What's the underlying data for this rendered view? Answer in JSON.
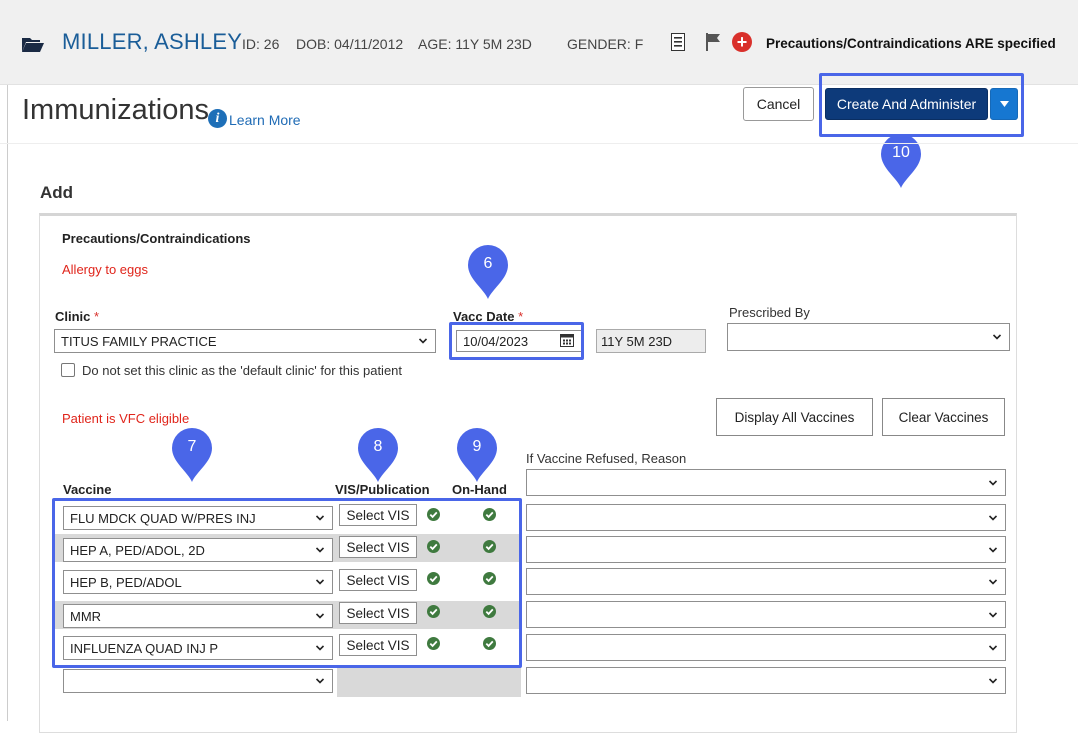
{
  "patient": {
    "name": "MILLER, ASHLEY",
    "id_label": "ID:",
    "id": "26",
    "dob_label": "DOB:",
    "dob": "04/11/2012",
    "age_label": "AGE:",
    "age": "11Y 5M 23D",
    "gender_label": "GENDER:",
    "gender": "F",
    "precautions_banner": "Precautions/Contraindications ARE specified"
  },
  "header": {
    "title": "Immunizations",
    "learn_more": "Learn More",
    "cancel_label": "Cancel",
    "create_label": "Create And Administer"
  },
  "markers": {
    "m6": "6",
    "m7": "7",
    "m8": "8",
    "m9": "9",
    "m10": "10"
  },
  "form": {
    "section_title": "Add",
    "precautions_title": "Precautions/Contraindications",
    "allergy": "Allergy to eggs",
    "clinic_label": "Clinic",
    "required_mark": "*",
    "clinic_value": "TITUS FAMILY PRACTICE",
    "default_clinic_checkbox": "Do not set this clinic as the 'default clinic' for this patient",
    "vacc_date_label": "Vacc Date",
    "vacc_date_value": "10/04/2023",
    "age_value": "11Y 5M 23D",
    "prescribed_by_label": "Prescribed By",
    "prescribed_by_value": "",
    "vfc_status": "Patient is VFC eligible",
    "display_all_label": "Display All Vaccines",
    "clear_label": "Clear Vaccines"
  },
  "table": {
    "col_vaccine": "Vaccine",
    "col_vis": "VIS/Publication",
    "col_onhand": "On-Hand",
    "col_refused": "If Vaccine Refused, Reason",
    "vis_button_label": "Select VIS",
    "rows": [
      {
        "vaccine": "FLU MDCK QUAD W/PRES INJ",
        "vis_ok": true,
        "on_hand": true,
        "refused_reason": ""
      },
      {
        "vaccine": "HEP A, PED/ADOL, 2D",
        "vis_ok": true,
        "on_hand": true,
        "refused_reason": ""
      },
      {
        "vaccine": "HEP B, PED/ADOL",
        "vis_ok": true,
        "on_hand": true,
        "refused_reason": ""
      },
      {
        "vaccine": "MMR",
        "vis_ok": true,
        "on_hand": true,
        "refused_reason": ""
      },
      {
        "vaccine": "INFLUENZA QUAD INJ P",
        "vis_ok": true,
        "on_hand": true,
        "refused_reason": ""
      },
      {
        "vaccine": "",
        "refused_reason": ""
      }
    ]
  },
  "colors": {
    "brand_blue": "#1a5d98",
    "highlight": "#4a66e8",
    "primary_button": "#0d3a7a",
    "alert_red": "#e0251b",
    "check_green": "#3f7a3f"
  }
}
